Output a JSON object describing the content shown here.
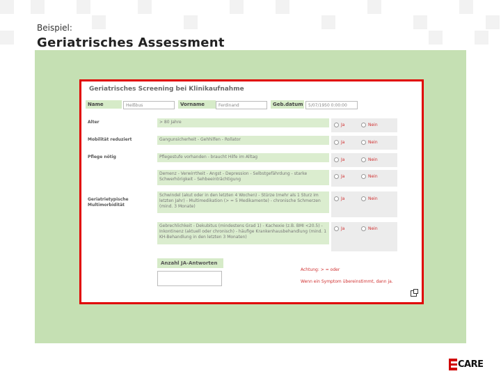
{
  "slide": {
    "kicker": "Beispiel:",
    "title": "Geriatrisches Assessment"
  },
  "form": {
    "heading": "Geriatrisches Screening bei Klinikaufnahme",
    "fields": {
      "name_label": "Name",
      "name_value": "Heißbus",
      "vorname_label": "Vorname",
      "vorname_value": "Ferdinand",
      "gebdatum_label": "Geb.datum",
      "gebdatum_value": "5/07/1950 0:00:00"
    },
    "options": {
      "yes": "Ja",
      "no": "Nein"
    },
    "rows": [
      {
        "label": "Alter",
        "description": "> 80 Jahre"
      },
      {
        "label": "Mobilität reduziert",
        "description": "Gangunsicherheit - Gehhilfen - Rollator"
      },
      {
        "label": "Pflege nötig",
        "description": "Pflegestufe vorhanden - braucht Hilfe im Alltag"
      },
      {
        "label": "",
        "description": "Demenz - Verwirrtheit - Angst - Depression - Selbstgefährdung - starke Schwerhörigkeit - Sehbeeinträchtigung"
      },
      {
        "label": "Geriatrietypische Multimorbidität",
        "description": "Schwindel (akut oder in den letzten 4 Wochen) - Stürze (mehr als 1 Sturz im letzten Jahr) - Multimedikation (> = 5 Medikamente) - chronische Schmerzen (mind. 3 Monate)"
      },
      {
        "label": "",
        "description": "Gebrechlichkeit - Dekubitus (mindestens Grad 1) - Kachexie (z.B. BMI <20.5) - Inkontinenz (aktuell oder chronisch) - häufige Krankenhausbehandlung (mind. 1 KH-Behandlung in den letzten 3 Monaten)"
      }
    ],
    "count_label": "Anzahl JA-Antworten",
    "note_1": "Achtung: > = oder",
    "note_2": "Wenn ein Symptom übereinstimmt, dann ja."
  },
  "logo": {
    "text": "CARE"
  },
  "colors": {
    "panel": "#c5e0b3",
    "frame": "#e00000",
    "label_bg": "#d6ebc8",
    "option_text": "#d03030"
  }
}
